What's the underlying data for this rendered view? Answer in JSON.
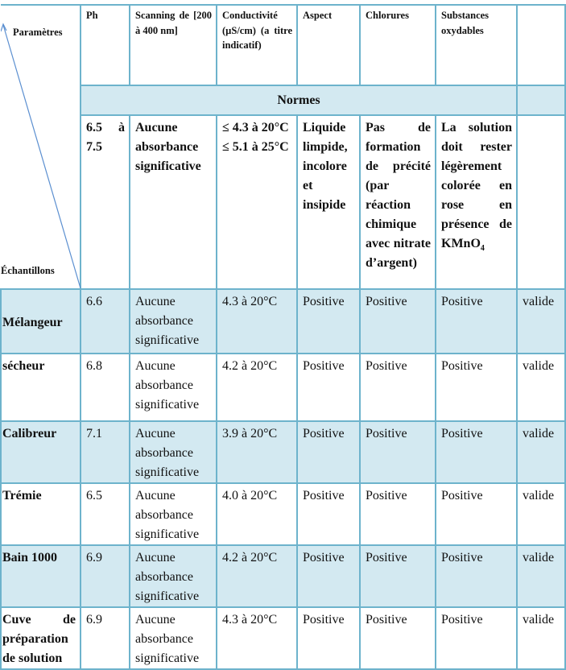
{
  "table": {
    "corner": {
      "top_label": "Paramètres",
      "bottom_label": "Échantillons"
    },
    "columns": [
      "Ph",
      "Scanning de [200 à 400 nm]",
      "Conductivité (µS/cm) (a titre indicatif)",
      "Aspect",
      "Chlorures",
      "Substances oxydables",
      ""
    ],
    "normes_label": "Normes",
    "norms": {
      "ph": "6.5 à 7.5",
      "scanning": "Aucune absorbance significative",
      "conductivity_line1": "≤ 4.3 à 20°C",
      "conductivity_line2": "≤ 5.1 à 25°C",
      "aspect": "Liquide limpide, incolore et insipide",
      "chlorures": "Pas de formation de précité (par réaction chimique avec nitrate d’argent)",
      "substances_prefix": "La solution doit rester légèrement colorée en rose en présence de KMnO",
      "substances_subscript": "4"
    },
    "rows": [
      {
        "sample": "Mélangeur",
        "ph": "6.6",
        "scanning": "Aucune absorbance significative",
        "conductivity": "4.3 à 20°C",
        "aspect": "Positive",
        "chlorures": "Positive",
        "substances": "Positive",
        "status": "valide"
      },
      {
        "sample": "sécheur",
        "ph": "6.8",
        "scanning": "Aucune absorbance significative",
        "conductivity": "4.2 à 20°C",
        "aspect": "Positive",
        "chlorures": "Positive",
        "substances": "Positive",
        "status": "valide"
      },
      {
        "sample": "Calibreur",
        "ph": "7.1",
        "scanning": "Aucune absorbance significative",
        "conductivity": "3.9 à 20°C",
        "aspect": "Positive",
        "chlorures": "Positive",
        "substances": "Positive",
        "status": "valide"
      },
      {
        "sample": "Trémie",
        "ph": "6.5",
        "scanning": "Aucune absorbance significative",
        "conductivity": "4.0 à 20°C",
        "aspect": "Positive",
        "chlorures": "Positive",
        "substances": "Positive",
        "status": "valide"
      },
      {
        "sample": "Bain 1000",
        "ph": "6.9",
        "scanning": "Aucune absorbance significative",
        "conductivity": "4.2 à 20°C",
        "aspect": "Positive",
        "chlorures": "Positive",
        "substances": "Positive",
        "status": "valide"
      },
      {
        "sample": "Cuve de préparation de solution",
        "ph": "6.9",
        "scanning": "Aucune absorbance significative",
        "conductivity": "4.3 à 20°C",
        "aspect": "Positive",
        "chlorures": "Positive",
        "substances": "Positive",
        "status": "valide"
      }
    ],
    "colors": {
      "border": "#6db3cc",
      "shaded_row": "#d3e9f1",
      "diagonal_line": "#5b8fd0"
    }
  }
}
